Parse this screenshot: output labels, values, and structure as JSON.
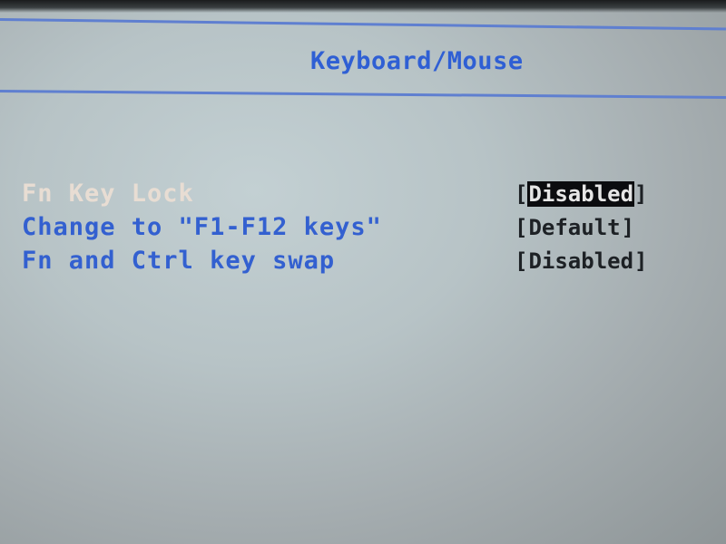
{
  "header": {
    "title": "Keyboard/Mouse"
  },
  "settings": [
    {
      "label": "Fn Key Lock",
      "value": "Disabled",
      "selected": true
    },
    {
      "label": "Change to \"F1-F12 keys\"",
      "value": "Default",
      "selected": false
    },
    {
      "label": "Fn and Ctrl key swap",
      "value": "Disabled",
      "selected": false
    }
  ],
  "colors": {
    "accent_blue": "#3360d0",
    "selected_label": "#e8ddd3",
    "highlight_bg": "#0b0c0f",
    "background": "#b7c3c6"
  }
}
